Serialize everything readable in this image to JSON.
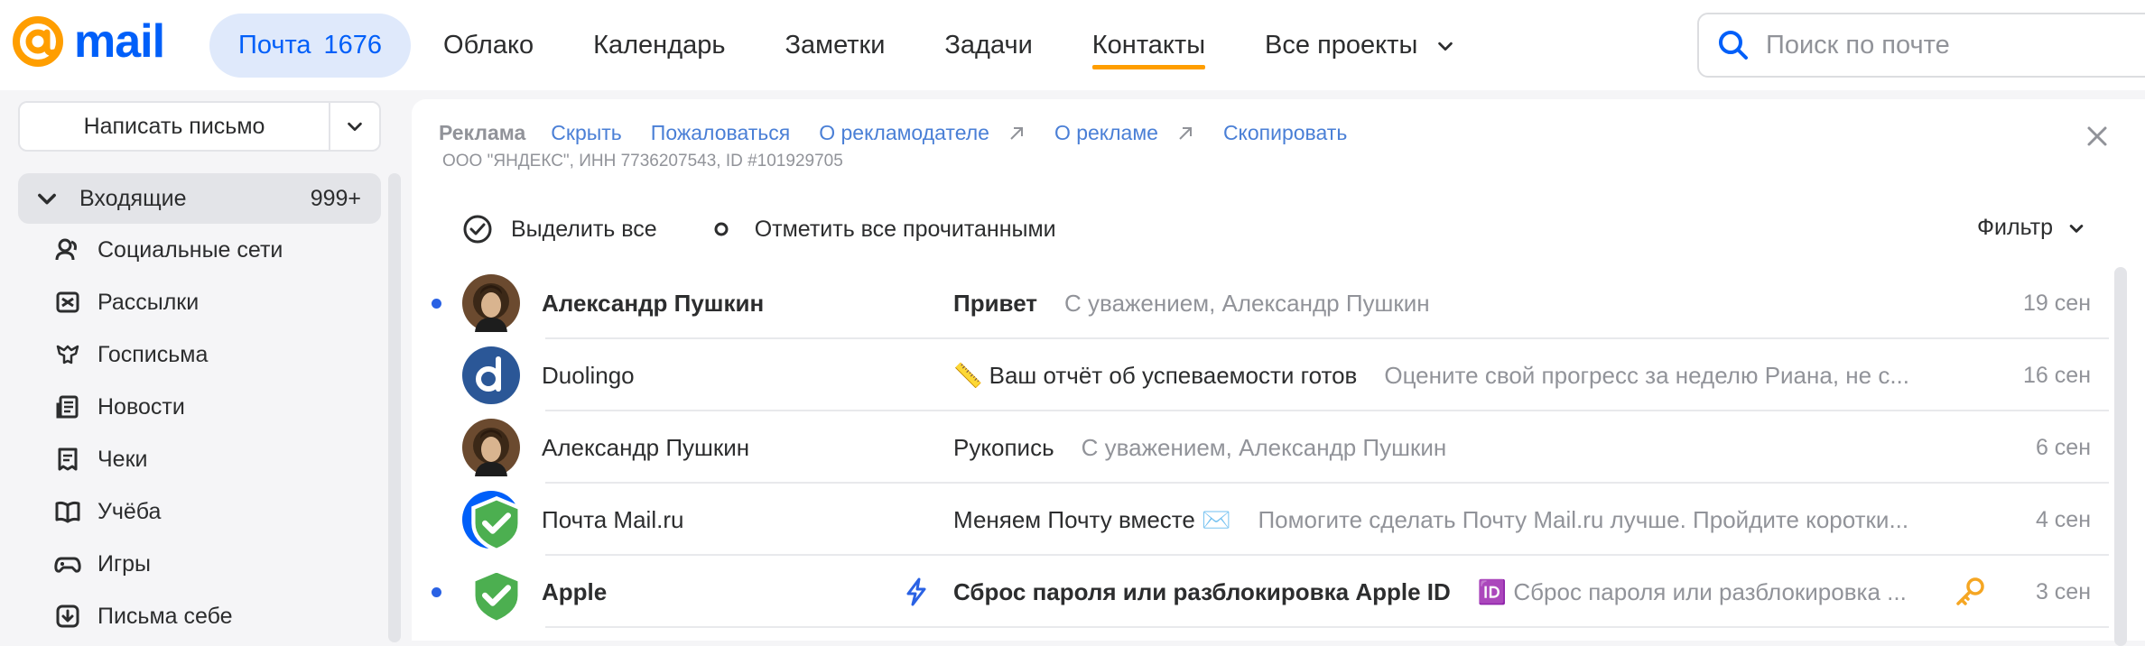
{
  "brand": {
    "logo_text": "mail",
    "accent": "#005ff9",
    "orange": "#ff9e00"
  },
  "nav": {
    "mail_label": "Почта",
    "mail_count": "1676",
    "items": [
      "Облако",
      "Календарь",
      "Заметки",
      "Задачи",
      "Контакты",
      "Все проекты"
    ]
  },
  "search": {
    "placeholder": "Поиск по почте"
  },
  "compose": {
    "label": "Написать письмо"
  },
  "folders": {
    "inbox_label": "Входящие",
    "inbox_badge": "999+",
    "sub": [
      "Социальные сети",
      "Рассылки",
      "Госписьма",
      "Новости",
      "Чеки",
      "Учёба",
      "Игры",
      "Письма себе"
    ]
  },
  "ad": {
    "label": "Реклама",
    "hide": "Скрыть",
    "complain": "Пожаловаться",
    "about_advertiser": "О рекламодателе",
    "about_ads": "О рекламе",
    "copy": "Скопировать",
    "legal": "ООО \"ЯНДЕКС\", ИНН 7736207543, ID #101929705"
  },
  "toolbar": {
    "select_all": "Выделить все",
    "mark_read": "Отметить все прочитанными",
    "filter": "Фильтр"
  },
  "messages": [
    {
      "sender": "Александр Пушкин",
      "subject": "Привет",
      "snippet": "С уважением, Александр Пушкин",
      "date": "19 сен",
      "unread": true,
      "avatar": "pushkin"
    },
    {
      "sender": "Duolingo",
      "subject": "📏 Ваш отчёт об успеваемости готов",
      "snippet": "Оцените свой прогресс за неделю Риана, не с...",
      "date": "16 сен",
      "unread": false,
      "avatar": "duolingo"
    },
    {
      "sender": "Александр Пушкин",
      "subject": "Рукопись",
      "snippet": "С уважением, Александр Пушкин",
      "date": "6 сен",
      "unread": false,
      "avatar": "pushkin"
    },
    {
      "sender": "Почта Mail.ru",
      "subject": "Меняем Почту вместе ✉️",
      "snippet": "Помогите сделать Почту Mail.ru лучше. Пройдите коротки...",
      "date": "4 сен",
      "unread": false,
      "avatar": "mailru"
    },
    {
      "sender": "Apple",
      "subject": "Сброс пароля или разблокировка Apple ID",
      "snippet": "🆔 Сброс пароля или разблокировка ...",
      "date": "3 сен",
      "unread": true,
      "avatar": "apple"
    }
  ]
}
